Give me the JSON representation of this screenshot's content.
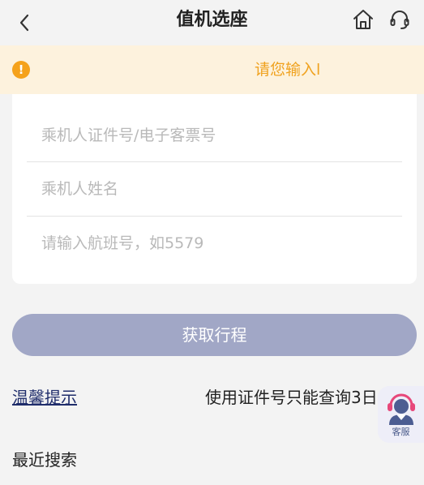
{
  "header": {
    "title": "值机选座"
  },
  "notice": {
    "message": "请您输入l"
  },
  "form": {
    "fields": [
      {
        "placeholder": "乘机人证件号/电子客票号"
      },
      {
        "placeholder": "乘机人姓名"
      },
      {
        "placeholder": "请输入航班号，如5579"
      }
    ],
    "submit_label": "获取行程"
  },
  "tips": {
    "link_label": "温馨提示",
    "text": "使用证件号只能查询3日"
  },
  "customer_service": {
    "label": "客服"
  },
  "recent": {
    "title": "最近搜索"
  },
  "colors": {
    "accent": "#f5a21b",
    "button": "#a1a7c6",
    "link": "#1f2d6b"
  }
}
